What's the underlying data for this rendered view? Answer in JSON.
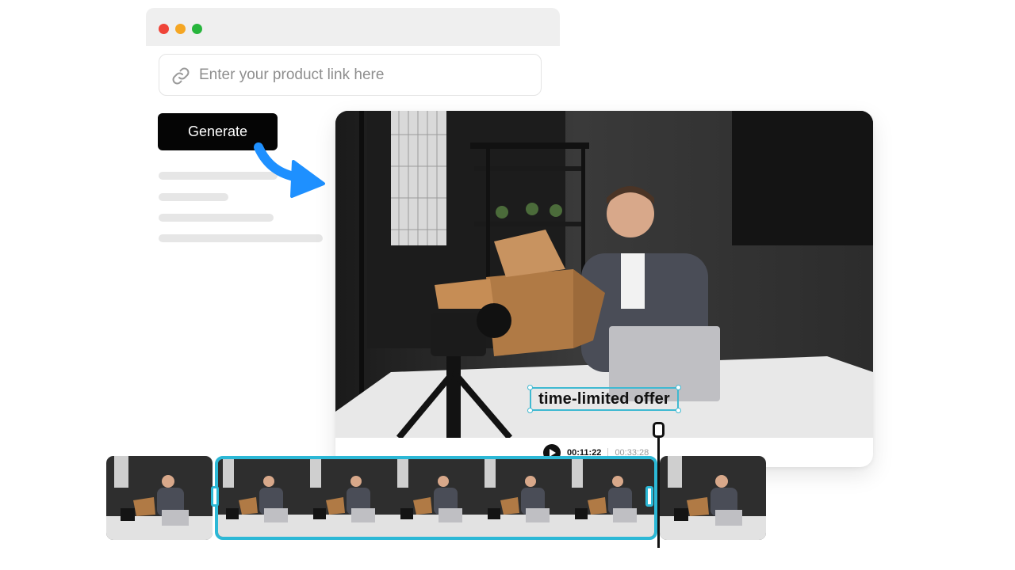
{
  "link_input": {
    "placeholder": "Enter your product link here",
    "icon": "link-icon"
  },
  "generate_button": {
    "label": "Generate"
  },
  "video": {
    "caption": "time-limited offer",
    "current_time": "00:11:22",
    "total_time": "00:33:28"
  },
  "colors": {
    "accent": "#2cb8d6",
    "arrow": "#1e90ff",
    "button_bg": "#050505",
    "window_red": "#ef4438",
    "window_yellow": "#f5a623",
    "window_green": "#27b53c"
  }
}
